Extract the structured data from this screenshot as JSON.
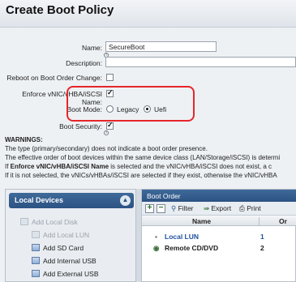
{
  "title": "Create Boot Policy",
  "form": {
    "name_label": "Name:",
    "name_value": "SecureBoot",
    "description_label": "Description:",
    "description_value": "",
    "reboot_label": "Reboot on Boot Order Change:",
    "reboot_checked": false,
    "enforce_label": "Enforce vNIC/vHBA/iSCSI Name:",
    "enforce_checked": true,
    "boot_mode_label": "Boot Mode:",
    "boot_mode_options": [
      "Legacy",
      "Uefi"
    ],
    "boot_mode_selected": "Uefi",
    "boot_security_label": "Boot Security:",
    "boot_security_checked": true,
    "info_glyph": "i"
  },
  "warnings": {
    "heading": "WARNINGS:",
    "line1": "The type (primary/secondary) does not indicate a boot order presence.",
    "line2": "The effective order of boot devices within the same device class (LAN/Storage/iSCSI) is determi",
    "line3_prefix": "If ",
    "line3_bold": "Enforce vNIC/vHBA/iSCSI Name",
    "line3_suffix": " is selected and the vNIC/vHBA/iSCSI does not exist, a c",
    "line4": "If it is not selected, the vNICs/vHBAs/iSCSI are selected if they exist, otherwise the vNIC/vHBA"
  },
  "local_devices": {
    "header": "Local Devices",
    "collapse_icon": "chevron-up-icon",
    "items": [
      {
        "label": "Add Local Disk",
        "enabled": false
      },
      {
        "label": "Add Local LUN",
        "enabled": false
      },
      {
        "label": "Add SD Card",
        "enabled": true
      },
      {
        "label": "Add Internal USB",
        "enabled": true
      },
      {
        "label": "Add External USB",
        "enabled": true
      }
    ]
  },
  "boot_order": {
    "header": "Boot Order",
    "toolbar": {
      "filter": "Filter",
      "export": "Export",
      "print": "Print"
    },
    "columns": [
      "Name",
      "Or"
    ],
    "rows": [
      {
        "name": "Local LUN",
        "order": "1",
        "color": "#1f4f9c"
      },
      {
        "name": "Remote CD/DVD",
        "order": "2",
        "color": "#1e1e1e"
      }
    ]
  },
  "colors": {
    "accent": "#2b5283",
    "highlight": "#e5262b"
  }
}
